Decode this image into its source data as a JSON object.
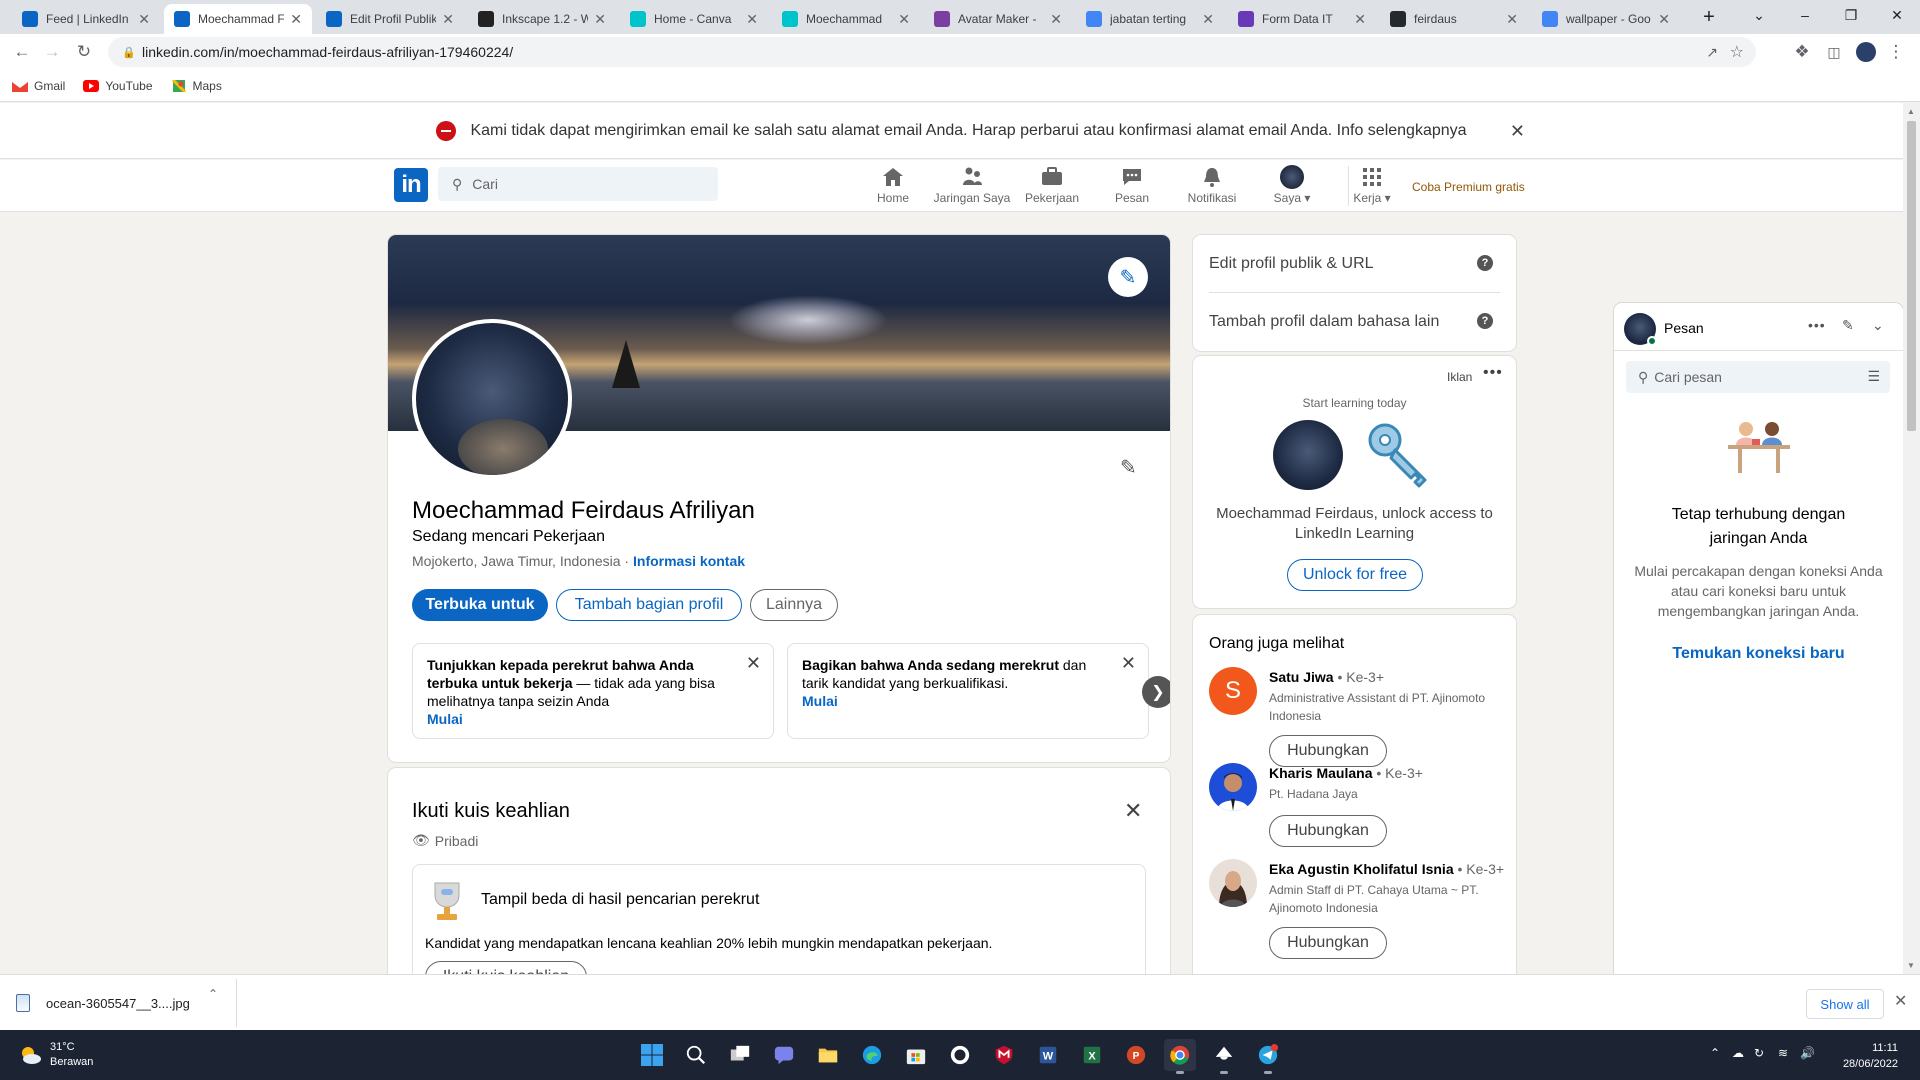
{
  "browser": {
    "tabs": [
      {
        "title": "Feed | LinkedIn",
        "icon": "linkedin-icon",
        "color": "#0a66c2"
      },
      {
        "title": "Moechammad Feirdaus",
        "icon": "linkedin-icon",
        "color": "#0a66c2",
        "active": true
      },
      {
        "title": "Edit Profil Publik",
        "icon": "linkedin-icon",
        "color": "#0a66c2"
      },
      {
        "title": "Inkscape 1.2 - W",
        "icon": "inkscape-icon",
        "color": "#222222"
      },
      {
        "title": "Home - Canva",
        "icon": "canva-icon",
        "color": "#00c4cc"
      },
      {
        "title": "Moechammad",
        "icon": "canva-icon",
        "color": "#00c4cc"
      },
      {
        "title": "Avatar Maker -",
        "icon": "avatar-maker-icon",
        "color": "#7b3fa1"
      },
      {
        "title": "jabatan terting",
        "icon": "google-icon",
        "color": "#4285f4"
      },
      {
        "title": "Form Data IT",
        "icon": "forms-icon",
        "color": "#673ab7"
      },
      {
        "title": "feirdaus",
        "icon": "github-icon",
        "color": "#24292e"
      },
      {
        "title": "wallpaper - Goo",
        "icon": "google-icon",
        "color": "#4285f4"
      }
    ],
    "url": "linkedin.com/in/moechammad-feirdaus-afriliyan-179460224/",
    "bookmarks": [
      {
        "label": "Gmail",
        "icon": "gmail-icon"
      },
      {
        "label": "YouTube",
        "icon": "youtube-icon"
      },
      {
        "label": "Maps",
        "icon": "maps-icon"
      }
    ]
  },
  "alert": {
    "message": "Kami tidak dapat mengirimkan email ke salah satu alamat email Anda. Harap perbarui atau konfirmasi alamat email Anda. Info selengkapnya"
  },
  "nav": {
    "search_placeholder": "Cari",
    "items": [
      {
        "label": "Home",
        "icon": "home-icon"
      },
      {
        "label": "Jaringan Saya",
        "icon": "network-icon"
      },
      {
        "label": "Pekerjaan",
        "icon": "briefcase-icon"
      },
      {
        "label": "Pesan",
        "icon": "messaging-icon"
      },
      {
        "label": "Notifikasi",
        "icon": "bell-icon"
      },
      {
        "label": "Saya",
        "icon": "me-avatar"
      },
      {
        "label": "Kerja",
        "icon": "grid-icon"
      }
    ],
    "premium": "Coba Premium gratis"
  },
  "profile": {
    "name": "Moechammad Feirdaus Afriliyan",
    "headline": "Sedang mencari Pekerjaan",
    "location": "Mojokerto, Jawa Timur, Indonesia",
    "contact_link": "Informasi kontak",
    "buttons": {
      "open_to": "Terbuka untuk",
      "add_section": "Tambah bagian profil",
      "more": "Lainnya"
    },
    "promos": [
      {
        "bold": "Tunjukkan kepada perekrut bahwa Anda terbuka untuk bekerja",
        "text": " — tidak ada yang bisa melihatnya tanpa seizin Anda",
        "link": "Mulai"
      },
      {
        "bold": "Bagikan bahwa Anda sedang merekrut",
        "text": " dan tarik kandidat yang berkualifikasi.",
        "link": "Mulai"
      }
    ]
  },
  "quiz": {
    "title": "Ikuti kuis keahlian",
    "privacy": "Pribadi",
    "heading": "Tampil beda di hasil pencarian perekrut",
    "desc": "Kandidat yang mendapatkan lencana keahlian 20% lebih mungkin mendapatkan pekerjaan.",
    "button": "Ikuti kuis keahlian"
  },
  "sidebar": {
    "edit_public": "Edit profil publik & URL",
    "add_language": "Tambah profil dalam bahasa lain",
    "ad": {
      "label": "Iklan",
      "start": "Start learning today",
      "text": "Moechammad Feirdaus, unlock access to LinkedIn Learning",
      "button": "Unlock for free"
    },
    "people_title": "Orang juga melihat",
    "people": [
      {
        "name": "Satu Jiwa",
        "degree": "• Ke-3+",
        "title": "Administrative Assistant di PT. Ajinomoto Indonesia",
        "button": "Hubungkan",
        "initial": "S",
        "color": "#f2571c"
      },
      {
        "name": "Kharis Maulana",
        "degree": "• Ke-3+",
        "title": "Pt. Hadana Jaya",
        "button": "Hubungkan",
        "color": "#1e4dd8"
      },
      {
        "name": "Eka Agustin Kholifatul Isnia",
        "degree": "• Ke-3+",
        "title": "Admin Staff di PT. Cahaya Utama ~ PT. Ajinomoto Indonesia",
        "button": "Hubungkan",
        "color": "#d9c9b8"
      }
    ]
  },
  "messaging": {
    "title": "Pesan",
    "search_placeholder": "Cari pesan",
    "heading": "Tetap terhubung dengan jaringan Anda",
    "desc": "Mulai percakapan dengan koneksi Anda atau cari koneksi baru untuk mengembangkan jaringan Anda.",
    "link": "Temukan koneksi baru"
  },
  "downloads": {
    "file": "ocean-3605547__3....jpg",
    "show_all": "Show all"
  },
  "taskbar": {
    "temp": "31°C",
    "weather": "Berawan",
    "time": "11:11",
    "date": "28/06/2022"
  }
}
